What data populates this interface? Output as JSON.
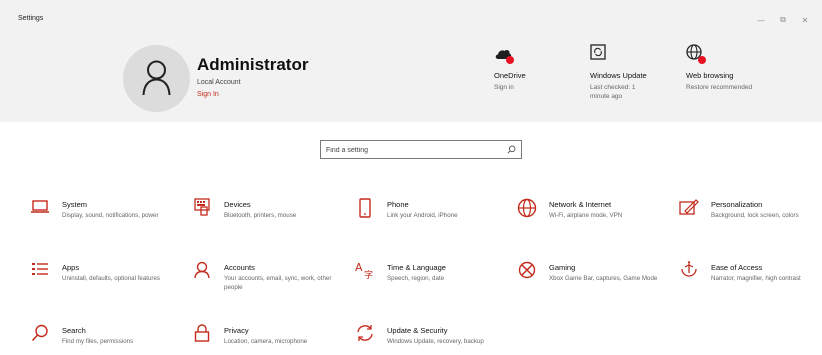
{
  "window": {
    "title": "Settings",
    "controls": {
      "minimize": "—",
      "restore": "⧉",
      "close": "✕"
    }
  },
  "account": {
    "name": "Administrator",
    "type": "Local Account",
    "sign_in": "Sign In"
  },
  "quick_actions": [
    {
      "icon": "onedrive-cloud-icon",
      "title": "OneDrive",
      "subtitle": "Sign in"
    },
    {
      "icon": "windows-update-icon",
      "title": "Windows Update",
      "subtitle": "Last checked: 1 minute ago"
    },
    {
      "icon": "globe-icon",
      "title": "Web browsing",
      "subtitle": "Restore recommended"
    }
  ],
  "search": {
    "placeholder": "Find a setting"
  },
  "categories": [
    {
      "icon": "laptop-icon",
      "title": "System",
      "desc": "Display, sound, notifications, power"
    },
    {
      "icon": "keyboard-icon",
      "title": "Devices",
      "desc": "Bluetooth, printers, mouse"
    },
    {
      "icon": "phone-icon",
      "title": "Phone",
      "desc": "Link your Android, iPhone"
    },
    {
      "icon": "globe-icon",
      "title": "Network & Internet",
      "desc": "Wi-Fi, airplane mode, VPN"
    },
    {
      "icon": "paintbrush-icon",
      "title": "Personalization",
      "desc": "Background, lock screen, colors"
    },
    {
      "icon": "apps-list-icon",
      "title": "Apps",
      "desc": "Uninstall, defaults, optional features"
    },
    {
      "icon": "person-icon",
      "title": "Accounts",
      "desc": "Your accounts, email, sync, work, other people"
    },
    {
      "icon": "language-icon",
      "title": "Time & Language",
      "desc": "Speech, region, date"
    },
    {
      "icon": "xbox-icon",
      "title": "Gaming",
      "desc": "Xbox Game Bar, captures, Game Mode"
    },
    {
      "icon": "accessibility-icon",
      "title": "Ease of Access",
      "desc": "Narrator, magnifier, high contrast"
    },
    {
      "icon": "search-icon",
      "title": "Search",
      "desc": "Find my files, permissions"
    },
    {
      "icon": "lock-icon",
      "title": "Privacy",
      "desc": "Location, camera, microphone"
    },
    {
      "icon": "sync-icon",
      "title": "Update & Security",
      "desc": "Windows Update, recovery, backup"
    }
  ],
  "colors": {
    "accent": "#c42b1c",
    "header_bg": "#f2f2f2",
    "alert_dot": "#e81123"
  }
}
